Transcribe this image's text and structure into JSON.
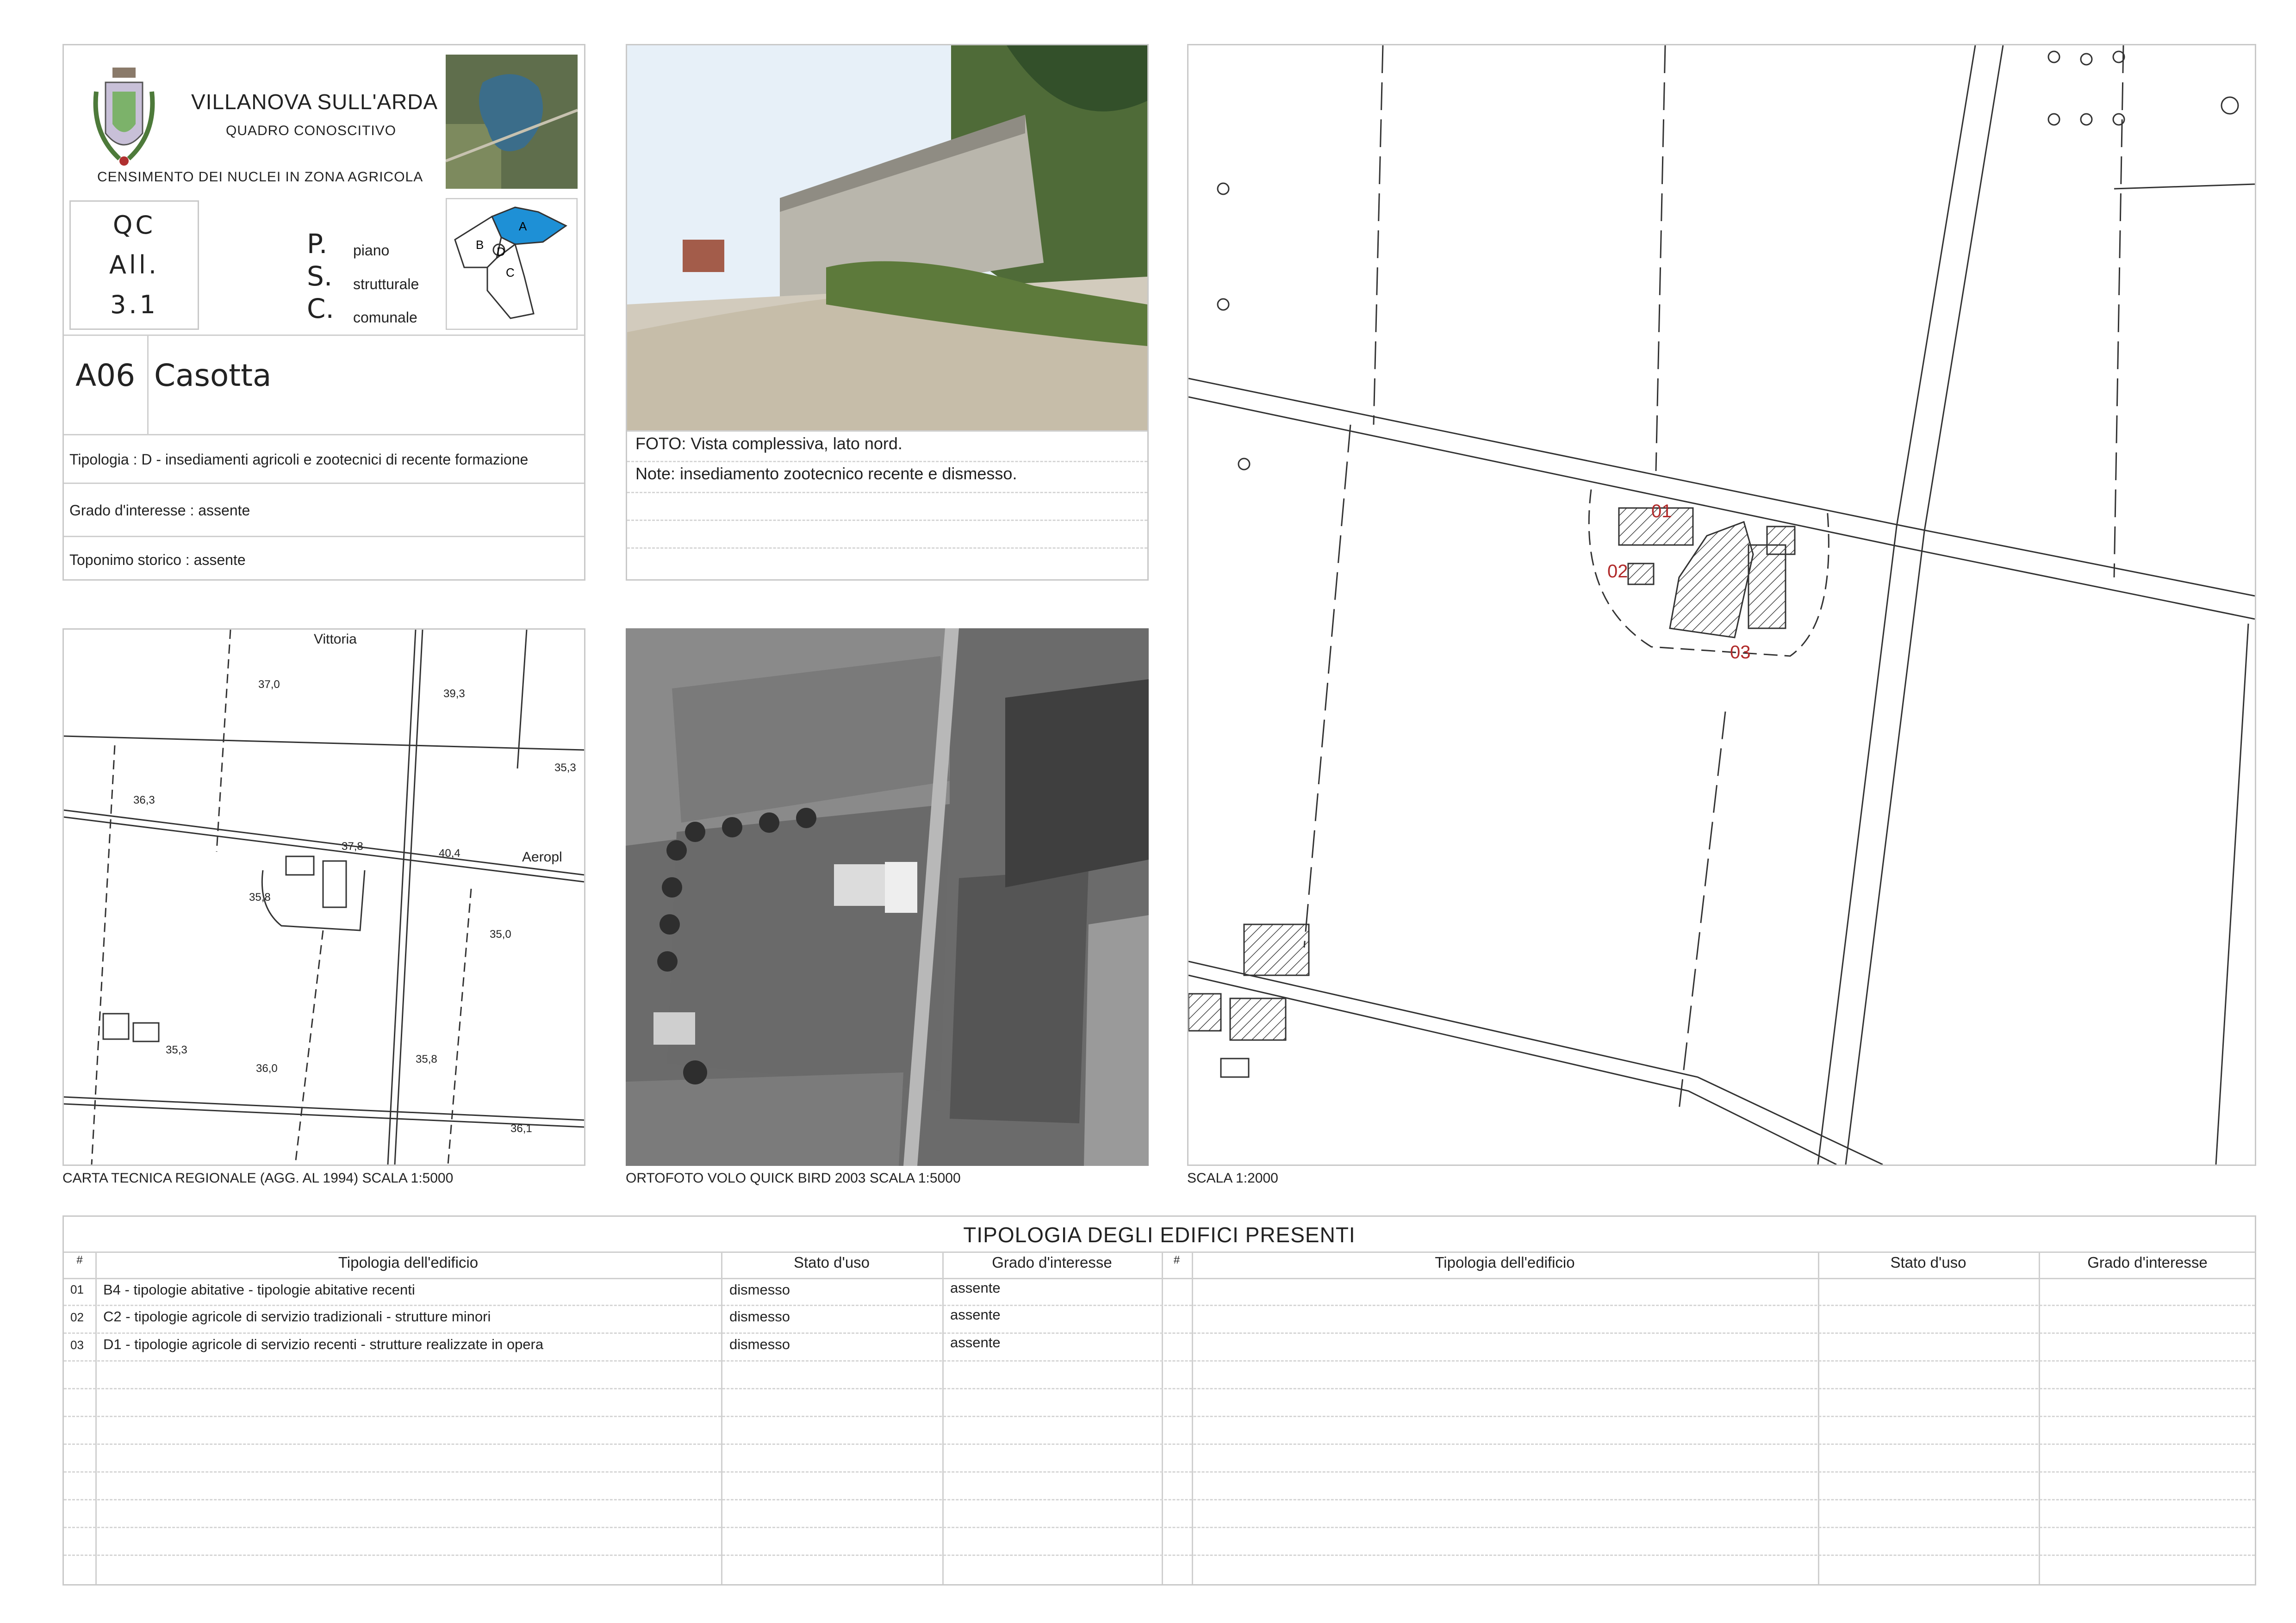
{
  "header": {
    "municipality": "VILLANOVA SULL'ARDA",
    "subtitle": "QUADRO CONOSCITIVO",
    "census": "CENSIMENTO DEI NUCLEI IN ZONA AGRICOLA",
    "qc_lines": [
      "QC",
      "All.",
      "3.1"
    ],
    "psc_letters": [
      "P.",
      "S.",
      "C."
    ],
    "psc_words": [
      "piano",
      "strutturale",
      "comunale"
    ],
    "zone_labels": [
      "A",
      "B",
      "D",
      "C"
    ],
    "code": "A06",
    "name": "Casotta",
    "tipologia": "Tipologia : D  - insediamenti agricoli e zootecnici di recente formazione",
    "grado": "Grado d'interesse : assente",
    "toponimo": "Toponimo storico : assente"
  },
  "photo": {
    "caption": "FOTO: Vista complessiva, lato nord.",
    "note": "Note: insediamento zootecnico recente e dismesso."
  },
  "maps": {
    "ctr_caption": "CARTA TECNICA REGIONALE (AGG. AL 1994) SCALA 1:5000",
    "ortho_caption": "ORTOFOTO VOLO QUICK BIRD 2003 SCALA 1:5000",
    "plan_caption": "SCALA 1:2000",
    "ctr_labels": [
      "Vittoria",
      "37,0",
      "39,3",
      "35,3",
      "36,3",
      "37,8",
      "40,4",
      "Aeropl",
      "35,8",
      "35,0",
      "35,3",
      "36,0",
      "35,8",
      "36,1"
    ],
    "plan_labels": [
      "01",
      "02",
      "03"
    ]
  },
  "table": {
    "title": "TIPOLOGIA DEGLI EDIFICI PRESENTI",
    "headers": [
      "#",
      "Tipologia dell'edificio",
      "Stato d'uso",
      "Grado d'interesse",
      "#",
      "Tipologia dell'edificio",
      "Stato d'uso",
      "Grado d'interesse"
    ],
    "rows": [
      {
        "n": "01",
        "tipologia": "B4 - tipologie abitative - tipologie abitative recenti",
        "stato": "dismesso",
        "grado": "assente"
      },
      {
        "n": "02",
        "tipologia": "C2 - tipologie agricole di servizio tradizionali - strutture minori",
        "stato": "dismesso",
        "grado": "assente"
      },
      {
        "n": "03",
        "tipologia": "D1 - tipologie agricole di servizio recenti - strutture realizzate in opera",
        "stato": "dismesso",
        "grado": "assente"
      }
    ]
  }
}
